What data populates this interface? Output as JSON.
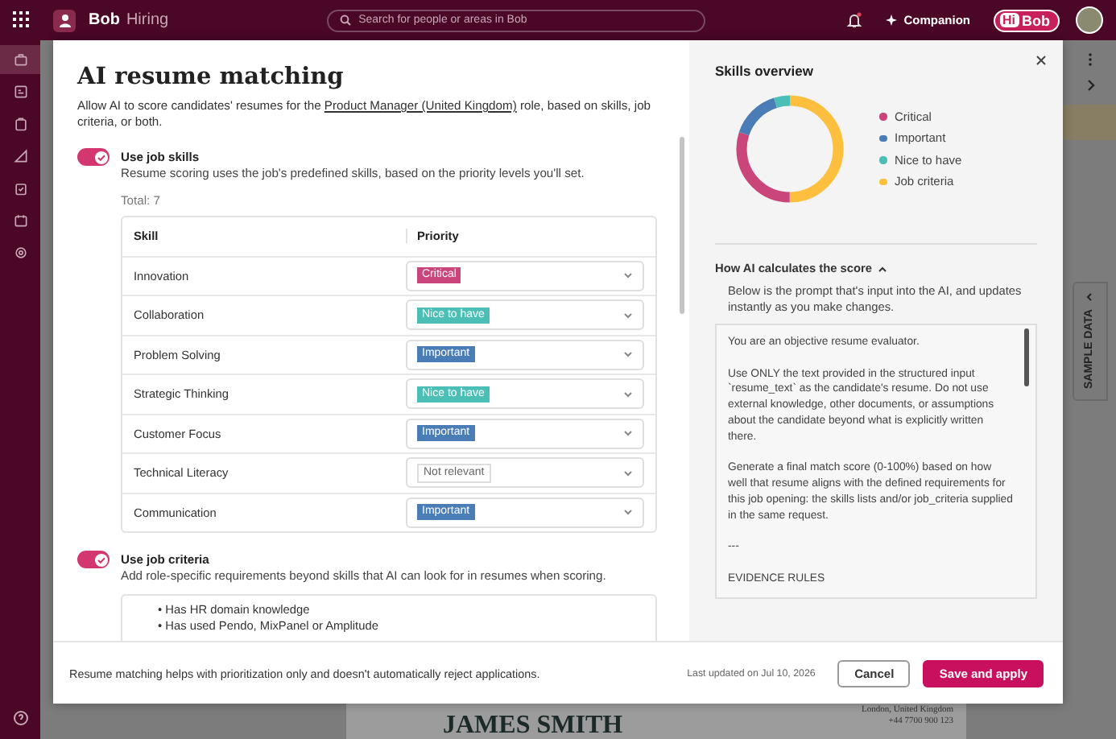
{
  "top_bar": {
    "app_name": "Bob",
    "module": "Hiring",
    "search": {
      "placeholder": "Search for people or areas in Bob"
    },
    "companion": "Companion",
    "logo": {
      "prefix": "Hi",
      "name": "Bob"
    }
  },
  "sidebar": {
    "items": [
      {
        "kind": "briefcase",
        "selected": true
      },
      {
        "kind": "card",
        "selected": false
      },
      {
        "kind": "clipboard",
        "selected": false
      },
      {
        "kind": "chart",
        "selected": false
      },
      {
        "kind": "check",
        "selected": false
      },
      {
        "kind": "calendar",
        "selected": false
      },
      {
        "kind": "gear",
        "selected": false
      }
    ]
  },
  "background": {
    "side_tab": "SAMPLE DATA",
    "resume": {
      "name": "JAMES SMITH",
      "contact": [
        "London, United Kingdom",
        "+44 7700 900 123"
      ]
    }
  },
  "dialog": {
    "title": "AI resume matching",
    "description": {
      "before": "Allow AI to score candidates' resumes for the ",
      "link": "Product Manager (United Kingdom)",
      "after": " role, based on skills, job criteria, or both."
    },
    "skills_section": {
      "toggle": {
        "label": "Use job skills",
        "on": true
      },
      "description": "Resume scoring uses the job's predefined skills, based on the priority levels you'll set.",
      "total": "Total: 7",
      "columns": [
        "Skill",
        "Priority"
      ],
      "rows": [
        {
          "skill": "Innovation",
          "priority": "Critical",
          "kind": "critical"
        },
        {
          "skill": "Collaboration",
          "priority": "Nice to have",
          "kind": "nice"
        },
        {
          "skill": "Problem Solving",
          "priority": "Important",
          "kind": "important"
        },
        {
          "skill": "Strategic Thinking",
          "priority": "Nice to have",
          "kind": "nice"
        },
        {
          "skill": "Customer Focus",
          "priority": "Important",
          "kind": "important"
        },
        {
          "skill": "Technical Literacy",
          "priority": "Not relevant",
          "kind": "none"
        },
        {
          "skill": "Communication",
          "priority": "Important",
          "kind": "important"
        }
      ]
    },
    "criteria_section": {
      "toggle": {
        "label": "Use job criteria",
        "on": true
      },
      "description": "Add role-specific requirements beyond skills that AI can look for in resumes when scoring.",
      "items": [
        {
          "marker": "•",
          "text": "Has HR domain knowledge"
        },
        {
          "marker": "•",
          "text": "Has used Pendo, MixPanel or Amplitude"
        }
      ]
    },
    "skills_overview": {
      "title": "Skills overview",
      "legend": [
        {
          "label": "Critical",
          "color": "#c9457a"
        },
        {
          "label": "Important",
          "color": "#4a7db5"
        },
        {
          "label": "Nice to have",
          "color": "#4bbfb5"
        },
        {
          "label": "Job criteria",
          "color": "#fcc03e"
        }
      ]
    },
    "score_section": {
      "title": "How AI calculates the score",
      "expanded": true,
      "description": "Below is the prompt that's input into the AI, and updates instantly as you make changes.",
      "prompt": [
        "You are an objective resume evaluator.",
        "Use ONLY the text provided in the structured input `resume_text` as the candidate's resume. Do not use external knowledge, other documents, or assumptions about the candidate beyond what is explicitly written there.",
        "Generate a final match score (0-100%) based on how well that resume aligns with the defined requirements for this job opening: the skills lists and/or job_criteria supplied in the same request.",
        "---",
        "EVIDENCE RULES"
      ]
    },
    "footer": {
      "note": "Resume matching helps with prioritization only and doesn't automatically reject applications.",
      "last_updated": "Last updated on Jul 10, 2026",
      "cancel": "Cancel",
      "save": "Save and apply"
    }
  }
}
